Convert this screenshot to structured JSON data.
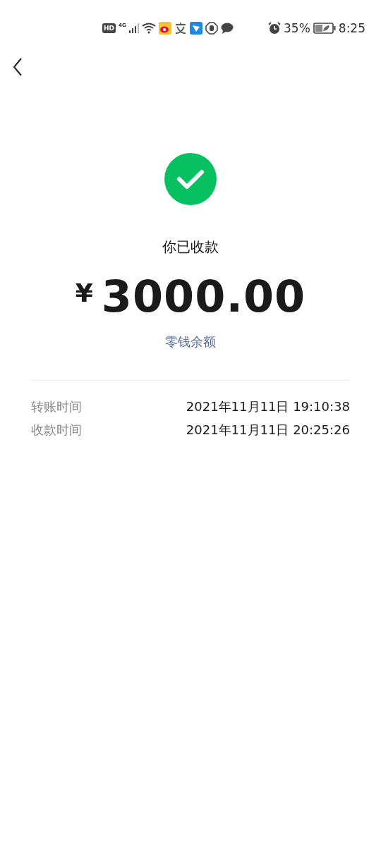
{
  "status_bar": {
    "hd_badge": "HD",
    "network": "4G",
    "battery": "35%",
    "time": "8:25"
  },
  "status": {
    "kind": "success",
    "title": "你已收款"
  },
  "amount": {
    "currency": "¥",
    "value": "3000.00"
  },
  "balance_link": "零钱余额",
  "details": [
    {
      "label": "转账时间",
      "value": "2021年11月11日 19:10:38"
    },
    {
      "label": "收款时间",
      "value": "2021年11月11日 20:25:26"
    }
  ]
}
